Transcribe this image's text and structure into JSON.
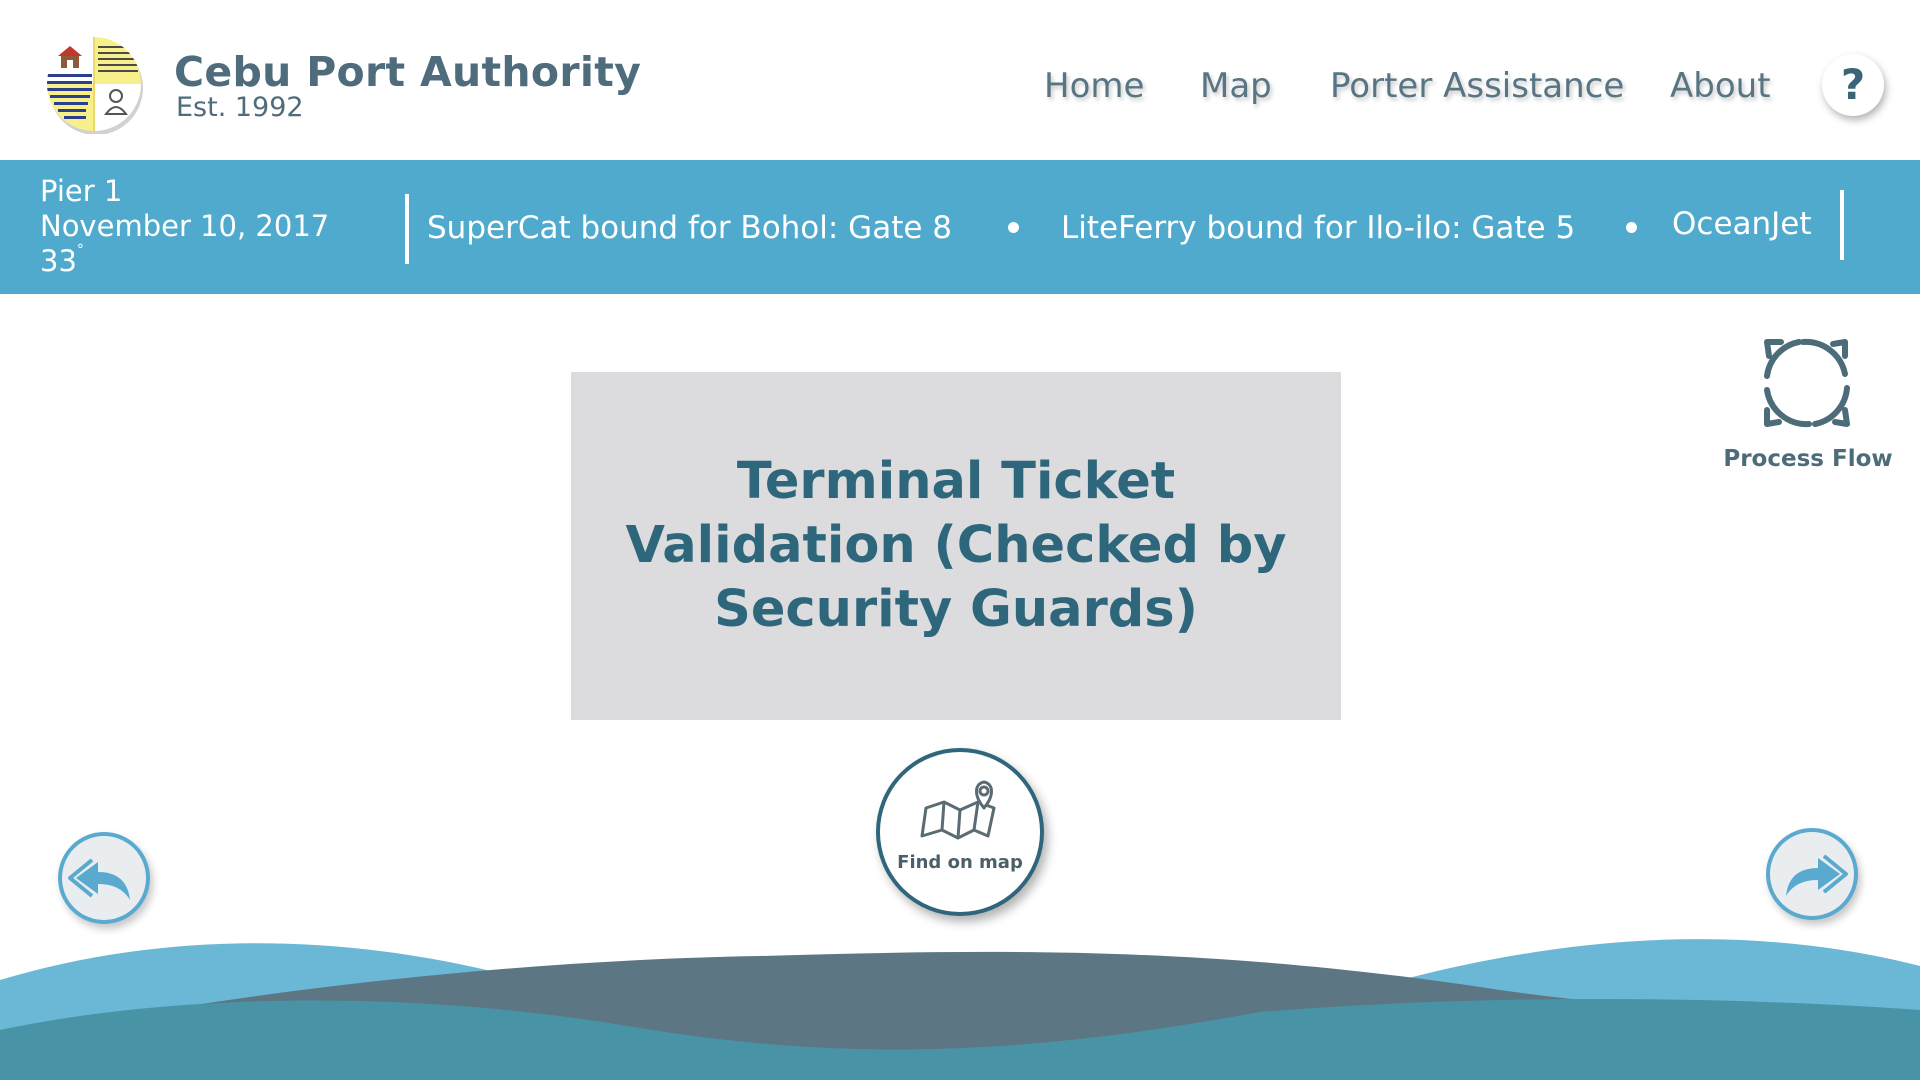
{
  "header": {
    "brand_title": "Cebu Port Authority",
    "brand_subtitle": "Est. 1992",
    "logo_icon": "cebu-port-authority-seal",
    "nav": [
      "Home",
      "Map",
      "Porter Assistance",
      "About"
    ],
    "help_label": "?"
  },
  "ticker": {
    "pier": "Pier 1",
    "date": "November 10, 2017",
    "temperature": "33",
    "temperature_unit": "°",
    "items": [
      "SuperCat bound for Bohol: Gate 8",
      "LiteFerry bound for Ilo-ilo: Gate 5",
      "OceanJet"
    ]
  },
  "main": {
    "step_title": "Terminal Ticket Validation (Checked by Security Guards)",
    "process_flow_label": "Process Flow",
    "find_on_map_label": "Find on map"
  },
  "navigation": {
    "back_icon": "double-reply-left-icon",
    "forward_icon": "double-forward-right-icon"
  },
  "colors": {
    "brand_blue": "#4faacd",
    "dark_teal": "#2e667c",
    "card_gray": "#dcdcde",
    "wave_light": "#6ab8d6",
    "wave_slate": "#5d7684",
    "wave_teal": "#4893a6"
  }
}
